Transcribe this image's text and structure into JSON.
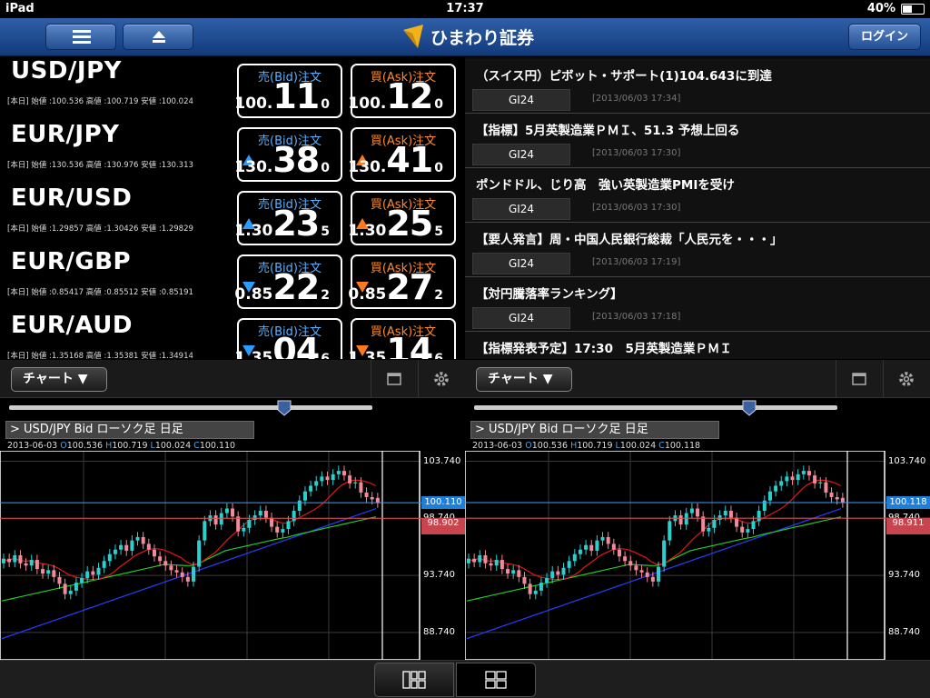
{
  "status": {
    "device": "iPad",
    "time": "17:37",
    "battery": "40%"
  },
  "nav": {
    "brand": "ひまわり証券",
    "login": "ログイン"
  },
  "quotes": [
    {
      "pair": "USD/JPY",
      "ohl": "[本日]  始値 :100.536   高値 :100.719   安値 :100.024",
      "bid_head": "売(Bid)注文",
      "ask_head": "買(Ask)注文",
      "bid": {
        "pre": "100.",
        "big": "11",
        "sm": "0",
        "dir": ""
      },
      "ask": {
        "pre": "100.",
        "big": "12",
        "sm": "0",
        "dir": ""
      }
    },
    {
      "pair": "EUR/JPY",
      "ohl": "[本日]  始値 :130.536   高値 :130.976   安値 :130.313",
      "bid_head": "売(Bid)注文",
      "ask_head": "買(Ask)注文",
      "bid": {
        "pre": "130.",
        "big": "38",
        "sm": "0",
        "dir": "up"
      },
      "ask": {
        "pre": "130.",
        "big": "41",
        "sm": "0",
        "dir": "up"
      }
    },
    {
      "pair": "EUR/USD",
      "ohl": "[本日]  始値 :1.29857   高値 :1.30426   安値 :1.29829",
      "bid_head": "売(Bid)注文",
      "ask_head": "買(Ask)注文",
      "bid": {
        "pre": "1.30",
        "big": "23",
        "sm": "5",
        "dir": "up"
      },
      "ask": {
        "pre": "1.30",
        "big": "25",
        "sm": "5",
        "dir": "up"
      }
    },
    {
      "pair": "EUR/GBP",
      "ohl": "[本日]  始値 :0.85417   高値 :0.85512   安値 :0.85191",
      "bid_head": "売(Bid)注文",
      "ask_head": "買(Ask)注文",
      "bid": {
        "pre": "0.85",
        "big": "22",
        "sm": "2",
        "dir": "dn"
      },
      "ask": {
        "pre": "0.85",
        "big": "27",
        "sm": "2",
        "dir": "dn"
      }
    },
    {
      "pair": "EUR/AUD",
      "ohl": "[本日]  始値 :1.35168   高値 :1.35381   安値 :1.34914",
      "bid_head": "売(Bid)注文",
      "ask_head": "買(Ask)注文",
      "bid": {
        "pre": "1.35",
        "big": "04",
        "sm": "6",
        "dir": "dn"
      },
      "ask": {
        "pre": "1.35",
        "big": "14",
        "sm": "6",
        "dir": "dn"
      }
    }
  ],
  "news": [
    {
      "title": "（スイス円）ピボット・サポート(1)104.643に到達",
      "source": "GI24",
      "date": "[2013/06/03 17:34]"
    },
    {
      "title": "【指標】5月英製造業ＰＭＩ、51.3 予想上回る",
      "source": "GI24",
      "date": "[2013/06/03 17:30]"
    },
    {
      "title": "ポンドドル、じり高　強い英製造業PMIを受け",
      "source": "GI24",
      "date": "[2013/06/03 17:30]"
    },
    {
      "title": "【要人発言】周・中国人民銀行総裁「人民元を・・・」",
      "source": "GI24",
      "date": "[2013/06/03 17:19]"
    },
    {
      "title": "【対円騰落率ランキング】",
      "source": "GI24",
      "date": "[2013/06/03 17:18]"
    },
    {
      "title": "【指標発表予定】17:30　5月英製造業ＰＭＩ",
      "source": "GI24",
      "date": ""
    }
  ],
  "panels": [
    {
      "button": "チャート ▼",
      "label": "> USD/JPY   Bid   ローソク足 日足",
      "date": "2013-06-03",
      "o": "100.536",
      "h": "100.719",
      "l": "100.024",
      "c": "100.110",
      "last": "100.110",
      "ma": "98.902",
      "yticks": [
        "103.740",
        "98.740",
        "93.740",
        "88.740"
      ]
    },
    {
      "button": "チャート ▼",
      "label": "> USD/JPY   Bid   ローソク足 日足",
      "date": "2013-06-03",
      "o": "100.536",
      "h": "100.719",
      "l": "100.024",
      "c": "100.118",
      "last": "100.118",
      "ma": "98.911",
      "yticks": [
        "103.740",
        "98.740",
        "93.740",
        "88.740"
      ]
    }
  ],
  "chart_data": [
    {
      "type": "candlestick",
      "title": "USD/JPY Bid ローソク足 日足",
      "ylim": [
        86.5,
        104.5
      ],
      "ticks": [
        103.74,
        98.74,
        93.74,
        88.74
      ],
      "close": [
        95.2,
        94.9,
        95.5,
        94.8,
        94.6,
        95.1,
        94.3,
        93.9,
        94.2,
        93.6,
        93.0,
        92.1,
        92.4,
        93.1,
        93.5,
        94.1,
        93.8,
        94.4,
        95.0,
        95.6,
        96.0,
        96.4,
        95.9,
        96.8,
        97.1,
        96.5,
        96.0,
        95.4,
        95.0,
        94.6,
        94.2,
        94.0,
        93.6,
        93.2,
        94.5,
        96.8,
        98.5,
        99.0,
        98.2,
        99.2,
        99.6,
        98.9,
        97.6,
        97.9,
        98.6,
        99.0,
        99.4,
        98.8,
        98.0,
        97.5,
        97.8,
        98.5,
        99.4,
        100.3,
        101.1,
        101.6,
        102.0,
        102.4,
        102.1,
        102.6,
        102.9,
        102.5,
        101.8,
        101.9,
        101.0,
        100.6,
        100.4,
        100.11
      ],
      "open": [
        94.8,
        95.2,
        94.9,
        95.5,
        94.8,
        94.6,
        95.1,
        94.3,
        93.9,
        94.2,
        93.6,
        93.0,
        92.1,
        92.4,
        93.1,
        93.5,
        94.1,
        93.8,
        94.4,
        95.0,
        95.6,
        96.0,
        96.4,
        95.9,
        96.8,
        97.1,
        96.5,
        96.0,
        95.4,
        95.0,
        94.6,
        94.2,
        94.0,
        93.6,
        93.2,
        94.5,
        96.8,
        98.5,
        99.0,
        98.2,
        99.2,
        99.6,
        98.9,
        97.6,
        97.9,
        98.6,
        99.0,
        99.4,
        98.8,
        98.0,
        97.5,
        97.8,
        98.5,
        99.4,
        100.3,
        101.1,
        101.6,
        102.0,
        102.4,
        102.1,
        102.6,
        102.9,
        102.5,
        101.8,
        101.9,
        101.0,
        100.6,
        100.536
      ]
    }
  ]
}
